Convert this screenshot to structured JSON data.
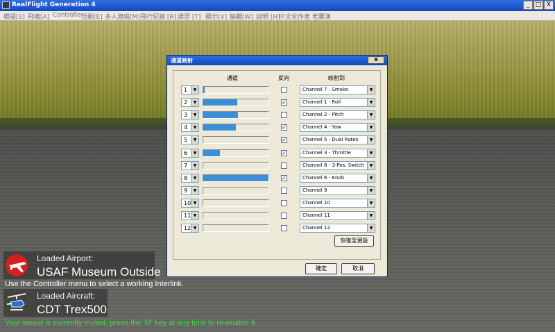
{
  "window": {
    "title": "RealFlight Generation 4",
    "controls": [
      "_",
      "□",
      "X"
    ]
  },
  "menu": [
    "模擬[S]",
    "飛機[A]",
    "Controller",
    "活動[E]",
    "多人連線[M]",
    "飛行紀錄 [R]",
    "課習 [T]",
    "顯示[V]",
    "編輯[W]",
    "說明 [H]",
    "中文化作者 老鷹漢"
  ],
  "dialog": {
    "title": "通道映射",
    "close_label": "x",
    "col_channel": "通道",
    "col_reverse": "反向",
    "col_map": "映射到",
    "rows": [
      {
        "num": "1",
        "level": 0.02,
        "reverse": false,
        "map": "Channel 7 - Smoke"
      },
      {
        "num": "2",
        "level": 0.52,
        "reverse": true,
        "map": "Channel 1 - Roll"
      },
      {
        "num": "3",
        "level": 0.53,
        "reverse": false,
        "map": "Channel 2 - Pitch"
      },
      {
        "num": "4",
        "level": 0.5,
        "reverse": true,
        "map": "Channel 4 - Yaw"
      },
      {
        "num": "5",
        "level": 0,
        "reverse": true,
        "map": "Channel 5 - Dual Rates"
      },
      {
        "num": "6",
        "level": 0.26,
        "reverse": true,
        "map": "Channel 3 - Throttle"
      },
      {
        "num": "7",
        "level": 0,
        "reverse": false,
        "map": "Channel 8 - 3-Pos. Switch"
      },
      {
        "num": "8",
        "level": 1.0,
        "reverse": true,
        "map": "Channel 6 - Knob"
      },
      {
        "num": "9",
        "level": 0,
        "reverse": false,
        "map": "Channel 9"
      },
      {
        "num": "10",
        "level": 0,
        "reverse": false,
        "map": "Channel 10"
      },
      {
        "num": "11",
        "level": 0,
        "reverse": false,
        "map": "Channel 11"
      },
      {
        "num": "12",
        "level": 0,
        "reverse": false,
        "map": "Channel 12"
      }
    ],
    "restore_label": "恢復至預設",
    "ok_label": "確定",
    "cancel_label": "取消"
  },
  "overlay": {
    "airport_caption": "Loaded Airport:",
    "airport_name": "USAF Museum Outside",
    "controller_msg": "Use the Controller menu to select a working Interlink.",
    "aircraft_caption": "Loaded Aircraft:",
    "aircraft_name": "CDT Trex500",
    "sound_msg": "Your sound is currently muted, press the 'M' key at any time to re-enable it."
  },
  "colors": {
    "bar": "#3b8fd6",
    "titlebar": "#1f5ad6",
    "muted_msg": "#3bdc3b"
  }
}
